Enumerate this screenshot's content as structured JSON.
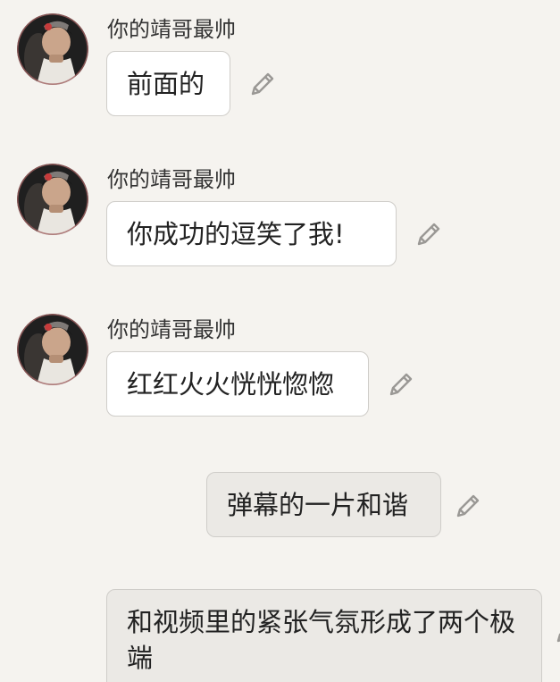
{
  "sender_name": "你的靖哥最帅",
  "messages": [
    {
      "text": "前面的",
      "side": "left",
      "edit_icon": "pencil-icon"
    },
    {
      "text": "你成功的逗笑了我!",
      "side": "left",
      "edit_icon": "pencil-icon"
    },
    {
      "text": "红红火火恍恍惚惚",
      "side": "left",
      "edit_icon": "pencil-icon"
    },
    {
      "text": "弹幕的一片和谐",
      "side": "right",
      "edit_icon": "pencil-icon"
    },
    {
      "text": "和视频里的紧张气氛形成了两个极端",
      "side": "right",
      "edit_icon": "pencil-icon"
    }
  ],
  "colors": {
    "background": "#f5f3ef",
    "incoming_bubble": "#ffffff",
    "outgoing_bubble": "#ebe9e5",
    "bubble_border": "#cfcdc9",
    "icon": "#9a9895"
  }
}
